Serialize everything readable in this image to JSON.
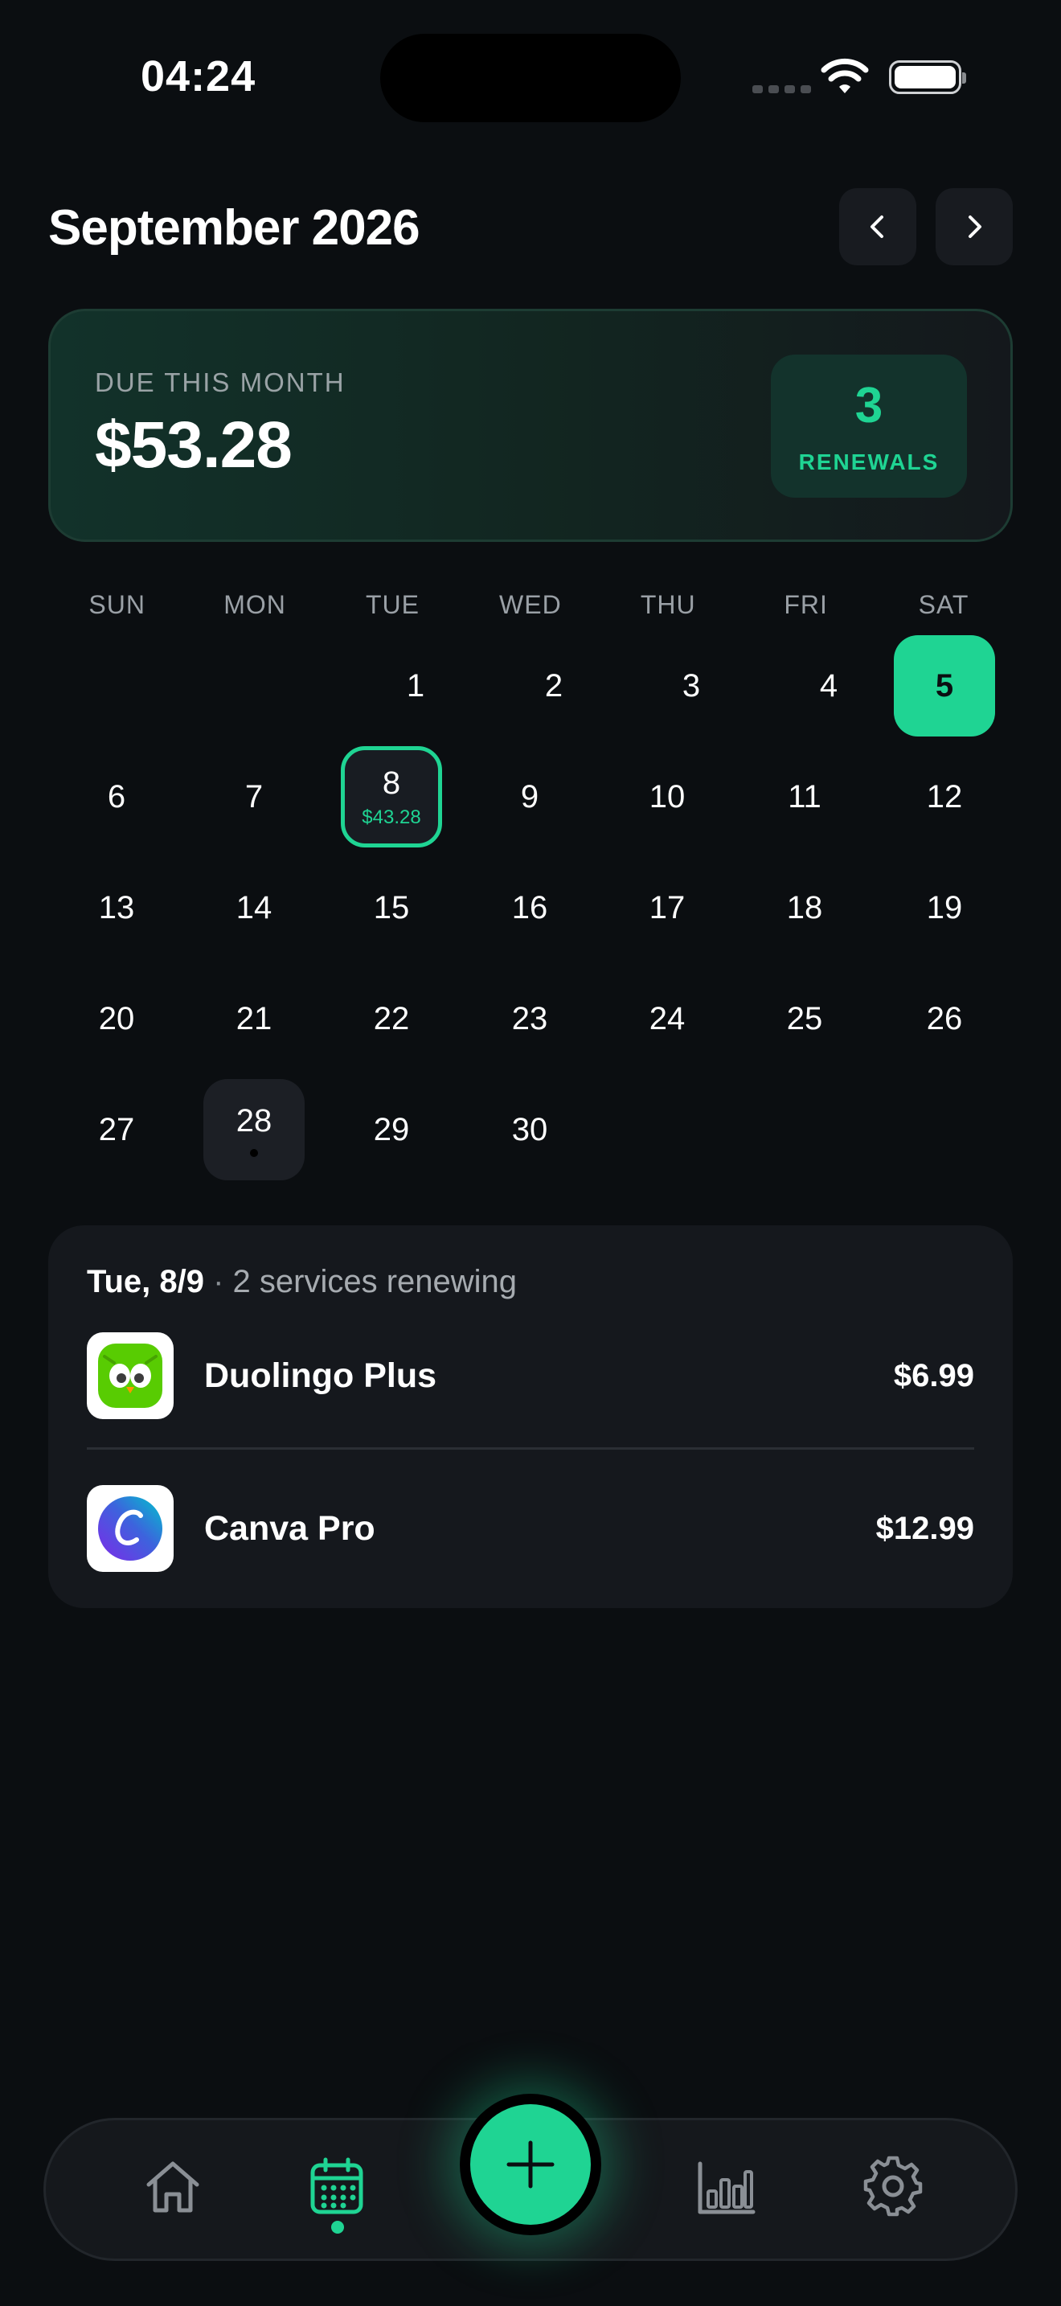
{
  "status_bar": {
    "time": "04:24"
  },
  "header": {
    "month_title": "September 2026"
  },
  "summary": {
    "label": "DUE THIS MONTH",
    "amount": "$53.28",
    "renewals_count": "3",
    "renewals_label": "RENEWALS"
  },
  "calendar": {
    "weekdays": [
      "SUN",
      "MON",
      "TUE",
      "WED",
      "THU",
      "FRI",
      "SAT"
    ],
    "days": [
      "1",
      "2",
      "3",
      "4",
      "5",
      "6",
      "7",
      "8",
      "9",
      "10",
      "11",
      "12",
      "13",
      "14",
      "15",
      "16",
      "17",
      "18",
      "19",
      "20",
      "21",
      "22",
      "23",
      "24",
      "25",
      "26",
      "27",
      "28",
      "29",
      "30"
    ],
    "selected_amount": "$43.28"
  },
  "detail": {
    "date": "Tue, 8/9",
    "separator": " · ",
    "subtitle": "2 services renewing",
    "items": [
      {
        "name": "Duolingo Plus",
        "price": "$6.99",
        "icon": "duolingo-icon"
      },
      {
        "name": "Canva Pro",
        "price": "$12.99",
        "icon": "canva-icon"
      }
    ]
  },
  "tabs": [
    {
      "icon": "home-icon"
    },
    {
      "icon": "calendar-icon",
      "active": true
    },
    {
      "icon": "add-icon"
    },
    {
      "icon": "chart-icon"
    },
    {
      "icon": "gear-icon"
    }
  ],
  "colors": {
    "accent": "#1fd493",
    "background": "#0b0e11",
    "card": "#15181d"
  }
}
